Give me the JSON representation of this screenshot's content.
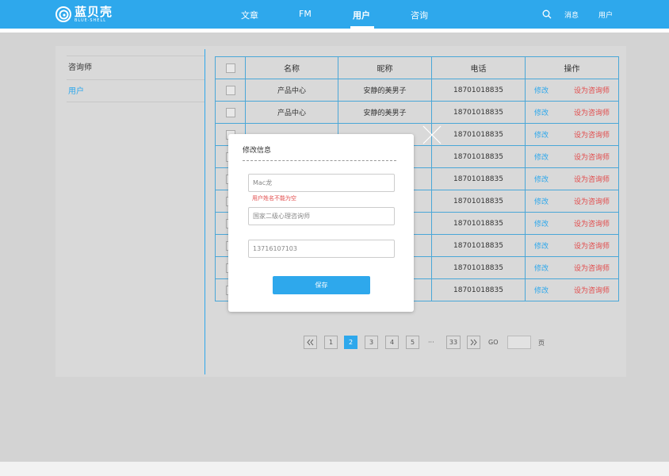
{
  "brand": {
    "name_cn": "蓝贝壳",
    "name_en": "BLUE·SHELL"
  },
  "nav": {
    "items": [
      "文章",
      "FM",
      "用户",
      "咨询"
    ],
    "active": "用户"
  },
  "top_right": {
    "search_icon": "search-icon",
    "messages": "消息",
    "user": "用户"
  },
  "sidebar": {
    "items": [
      {
        "label": "咨询师"
      },
      {
        "label": "用户",
        "active": true
      }
    ]
  },
  "table": {
    "headers": [
      "名称",
      "昵称",
      "电话",
      "操作"
    ],
    "rows": [
      {
        "name": "产品中心",
        "nickname": "安静的美男子",
        "phone": "18701018835"
      },
      {
        "name": "产品中心",
        "nickname": "安静的美男子",
        "phone": "18701018835"
      },
      {
        "name": "",
        "nickname": "",
        "phone": "18701018835"
      },
      {
        "name": "",
        "nickname": "",
        "phone": "18701018835"
      },
      {
        "name": "",
        "nickname": "",
        "phone": "18701018835"
      },
      {
        "name": "",
        "nickname": "",
        "phone": "18701018835"
      },
      {
        "name": "",
        "nickname": "",
        "phone": "18701018835"
      },
      {
        "name": "",
        "nickname": "",
        "phone": "18701018835"
      },
      {
        "name": "",
        "nickname": "",
        "phone": "18701018835"
      },
      {
        "name": "",
        "nickname": "",
        "phone": "18701018835"
      }
    ],
    "actions": {
      "edit": "修改",
      "set_counselor": "设为咨询师"
    }
  },
  "pagination": {
    "pages": [
      "1",
      "2",
      "3",
      "4",
      "5"
    ],
    "current": "2",
    "ellipsis": "···",
    "last": "33",
    "go_label": "GO",
    "page_suffix": "页"
  },
  "modal": {
    "title": "修改信息",
    "name_value": "Mac龙",
    "name_error": "用户姓名不能为空",
    "title_value": "国家二级心理咨询师",
    "phone_value": "13716107103",
    "save_label": "保存"
  },
  "colors": {
    "accent": "#2ea8ec",
    "danger": "#e24a4a"
  }
}
